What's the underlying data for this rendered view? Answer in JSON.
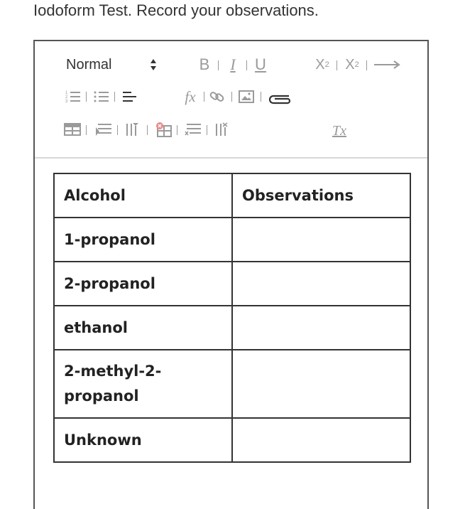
{
  "prompt": "Iodoform Test. Record your observations.",
  "toolbar": {
    "format_value": "Normal",
    "bold": "B",
    "italic": "I",
    "underline": "U",
    "subscript_base": "X",
    "subscript_mark": "2",
    "superscript_base": "X",
    "superscript_mark": "2",
    "formula": "fx",
    "clear_format": "Tx"
  },
  "table": {
    "headers": [
      "Alcohol",
      "Observations"
    ],
    "rows": [
      {
        "alcohol": "1-propanol",
        "observation": ""
      },
      {
        "alcohol": "2-propanol",
        "observation": ""
      },
      {
        "alcohol": "ethanol",
        "observation": ""
      },
      {
        "alcohol": "2-methyl-2-propanol",
        "observation": ""
      },
      {
        "alcohol": "Unknown",
        "observation": ""
      }
    ]
  }
}
